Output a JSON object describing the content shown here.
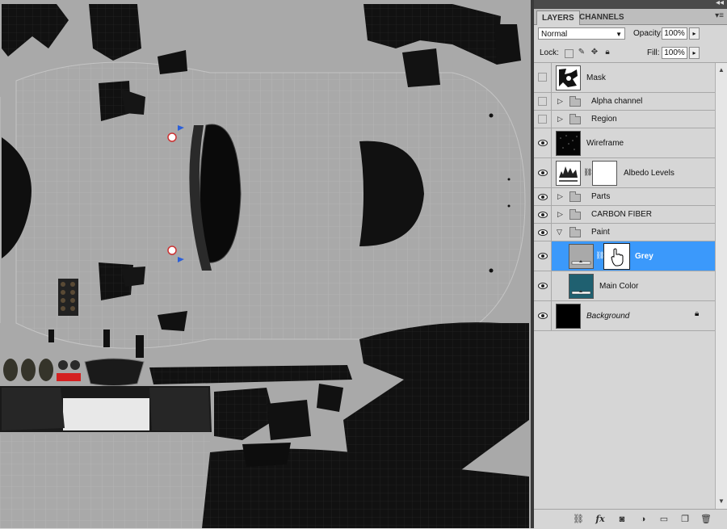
{
  "panel": {
    "tabs": [
      "LAYERS",
      "CHANNELS"
    ],
    "blend_mode": "Normal",
    "opacity_label": "Opacity:",
    "opacity_value": "100%",
    "lock_label": "Lock:",
    "fill_label": "Fill:",
    "fill_value": "100%"
  },
  "layers": [
    {
      "name": "Mask",
      "visible": false,
      "type": "layer"
    },
    {
      "name": "Alpha channel",
      "visible": false,
      "type": "group"
    },
    {
      "name": "Region",
      "visible": false,
      "type": "group"
    },
    {
      "name": "Wireframe",
      "visible": true,
      "type": "layer"
    },
    {
      "name": "Albedo Levels",
      "visible": true,
      "type": "adjustment"
    },
    {
      "name": "Parts",
      "visible": true,
      "type": "group"
    },
    {
      "name": "CARBON FIBER",
      "visible": true,
      "type": "group"
    },
    {
      "name": "Paint",
      "visible": true,
      "type": "group-open"
    },
    {
      "name": "Grey",
      "visible": true,
      "type": "fill",
      "selected": true
    },
    {
      "name": "Main Color",
      "visible": true,
      "type": "fill"
    },
    {
      "name": "Background",
      "visible": true,
      "type": "background",
      "locked": true
    }
  ],
  "colors": {
    "selection": "#3b99fb",
    "main_color_swatch": "#1f6070",
    "canvas_grey": "#a9a9a9"
  },
  "icons": {
    "bottom": [
      "link-layers-icon",
      "fx-icon",
      "add-mask-icon",
      "adjustment-layer-icon",
      "new-group-icon",
      "new-layer-icon",
      "delete-layer-icon"
    ]
  }
}
